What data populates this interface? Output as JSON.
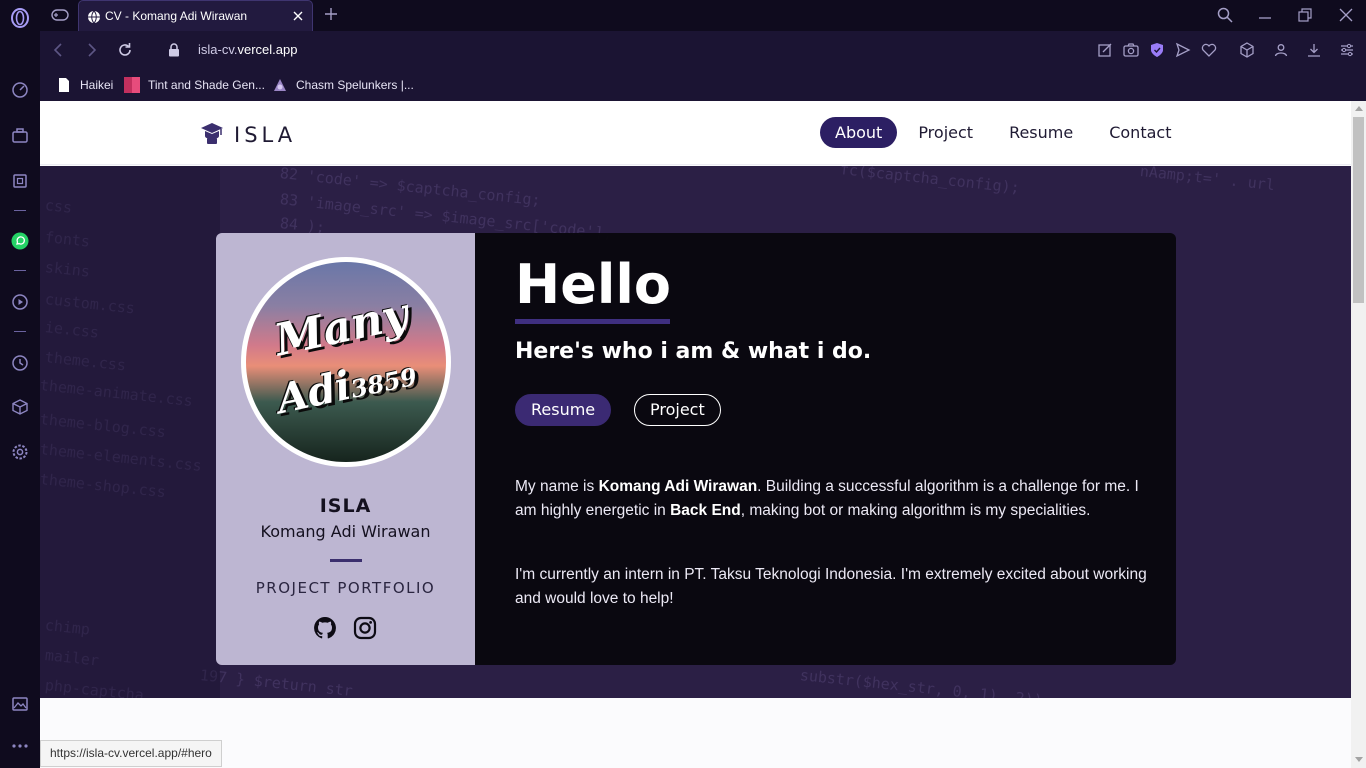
{
  "browser": {
    "tab": {
      "title": "CV - Komang Adi Wirawan"
    },
    "address": {
      "host_prefix": "isla-cv.",
      "host_main": "vercel.app"
    },
    "bookmarks": [
      {
        "label": "Haikei",
        "icon": "document-icon"
      },
      {
        "label": "Tint and Shade Gen...",
        "icon": "palette-icon"
      },
      {
        "label": "Chasm Spelunkers |...",
        "icon": "game-icon"
      }
    ],
    "status_url": "https://isla-cv.vercel.app/#hero",
    "accent": "#7b6cd9"
  },
  "site": {
    "brand": "ISLA",
    "nav": [
      {
        "label": "About",
        "active": true
      },
      {
        "label": "Project",
        "active": false
      },
      {
        "label": "Resume",
        "active": false
      },
      {
        "label": "Contact",
        "active": false
      }
    ],
    "profile": {
      "avatar_line1": "Many",
      "avatar_line2": "Adi",
      "avatar_line2_suffix": "3859",
      "name": "ISLA",
      "full_name": "Komang Adi Wirawan",
      "role": "PROJECT PORTFOLIO",
      "social": [
        "github-icon",
        "instagram-icon"
      ]
    },
    "hero": {
      "heading": "Hello",
      "subheading": "Here's who i am & what i do.",
      "resume_button": "Resume",
      "project_button": "Project",
      "p1_a": "My name is ",
      "p1_b": "Komang Adi Wirawan",
      "p1_c": ". Building a successful algorithm is a challenge for me. I am highly energetic in ",
      "p1_d": "Back End",
      "p1_e": ", making bot or making algorithm is my specialities.",
      "p2": "I'm currently an intern in PT. Taksu Teknologi Indonesia. I'm extremely excited about working and would love to help!"
    },
    "colors": {
      "primary": "#2c1f63",
      "card_left": "#bdb6d2",
      "hero_bg": "#2b1f45"
    }
  }
}
